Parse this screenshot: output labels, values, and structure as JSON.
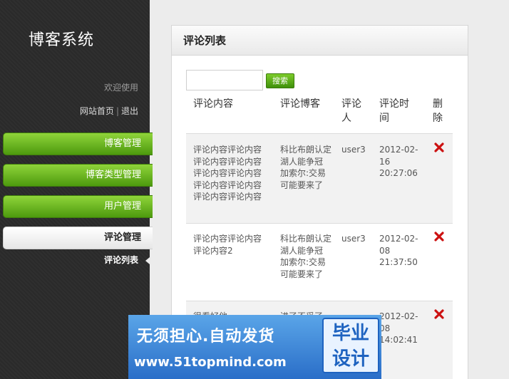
{
  "sidebar": {
    "site_title": "博客系统",
    "welcome": "欢迎使用",
    "home_link": "网站首页",
    "separator": "|",
    "logout_link": "退出",
    "nav": [
      {
        "label": "博客管理"
      },
      {
        "label": "博客类型管理"
      },
      {
        "label": "用户管理"
      },
      {
        "label": "评论管理"
      }
    ],
    "subnav_label": "评论列表"
  },
  "panel": {
    "title": "评论列表",
    "search": {
      "value": "",
      "button": "搜索"
    },
    "headers": [
      "评论内容",
      "评论博客",
      "评论人",
      "评论时间",
      "删除"
    ],
    "rows": [
      {
        "content": "评论内容评论内容评论内容评论内容评论内容评论内容评论内容评论内容评论内容评论内容",
        "blog": "科比布朗认定湖人能争冠 加索尔:交易可能要来了",
        "user": "user3",
        "time": "2012-02-16 20:27:06"
      },
      {
        "content": "评论内容评论内容评论内容2",
        "blog": "科比布朗认定湖人能争冠 加索尔:交易可能要来了",
        "user": "user3",
        "time": "2012-02-08 21:37:50"
      },
      {
        "content": "很看好他",
        "blog": "进了不妥了",
        "user": "",
        "time": "2012-02-08 14:02:41"
      }
    ],
    "delete_icon": "red-x-icon",
    "delete_color": "#cc1111"
  },
  "watermark": {
    "slogan": "无须担心.自动发货",
    "url": "www.51topmind.com",
    "badge": "毕业设计"
  }
}
